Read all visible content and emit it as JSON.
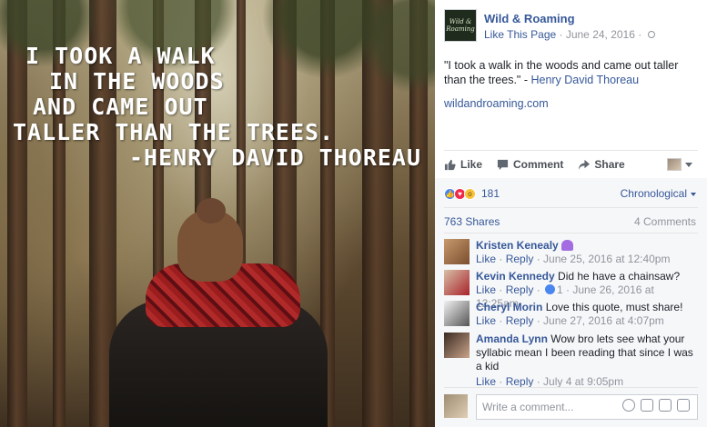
{
  "photo": {
    "quote_lines": [
      "I took a walk",
      "in the woods",
      "and came out",
      "taller than the trees.",
      "-Henry David Thoreau"
    ]
  },
  "post": {
    "page_name": "Wild & Roaming",
    "like_page": "Like This Page",
    "date": " · June 24, 2016 · ",
    "avatar_text": "Wild & Roaming",
    "text_quote": "\"I took a walk in the woods and came out taller than the trees.\" - ",
    "text_author": "Henry David Thoreau",
    "link": "wildandroaming.com"
  },
  "actions": {
    "like": "Like",
    "comment": "Comment",
    "share": "Share"
  },
  "stats": {
    "reaction_count": "181",
    "sort": "Chronological",
    "shares": "763 Shares",
    "comments_count": "4 Comments"
  },
  "comments": [
    {
      "name": "Kristen Kenealy",
      "text": "",
      "like": "Like",
      "reply": "Reply",
      "time": " · June 25, 2016 at 12:40pm",
      "reactions": ""
    },
    {
      "name": "Kevin Kennedy",
      "text": "Did he have a chainsaw?",
      "like": "Like",
      "reply": "Reply",
      "time": "1 · June 26, 2016 at 12:25am",
      "reactions": "1"
    },
    {
      "name": "Cheryl Morin",
      "text": "Love this quote, must share!",
      "like": "Like",
      "reply": "Reply",
      "time": " · June 27, 2016 at 4:07pm",
      "reactions": ""
    },
    {
      "name": "Amanda Lynn",
      "text": "Wow bro lets see what your syllabic mean I been reading that since I was a kid",
      "like": "Like",
      "reply": "Reply",
      "time": " · July 4 at 9:05pm",
      "reactions": ""
    }
  ],
  "composer": {
    "placeholder": "Write a comment..."
  },
  "colors": {
    "link": "#365899",
    "meta": "#90949c",
    "panel_gray": "#f6f7f9"
  }
}
